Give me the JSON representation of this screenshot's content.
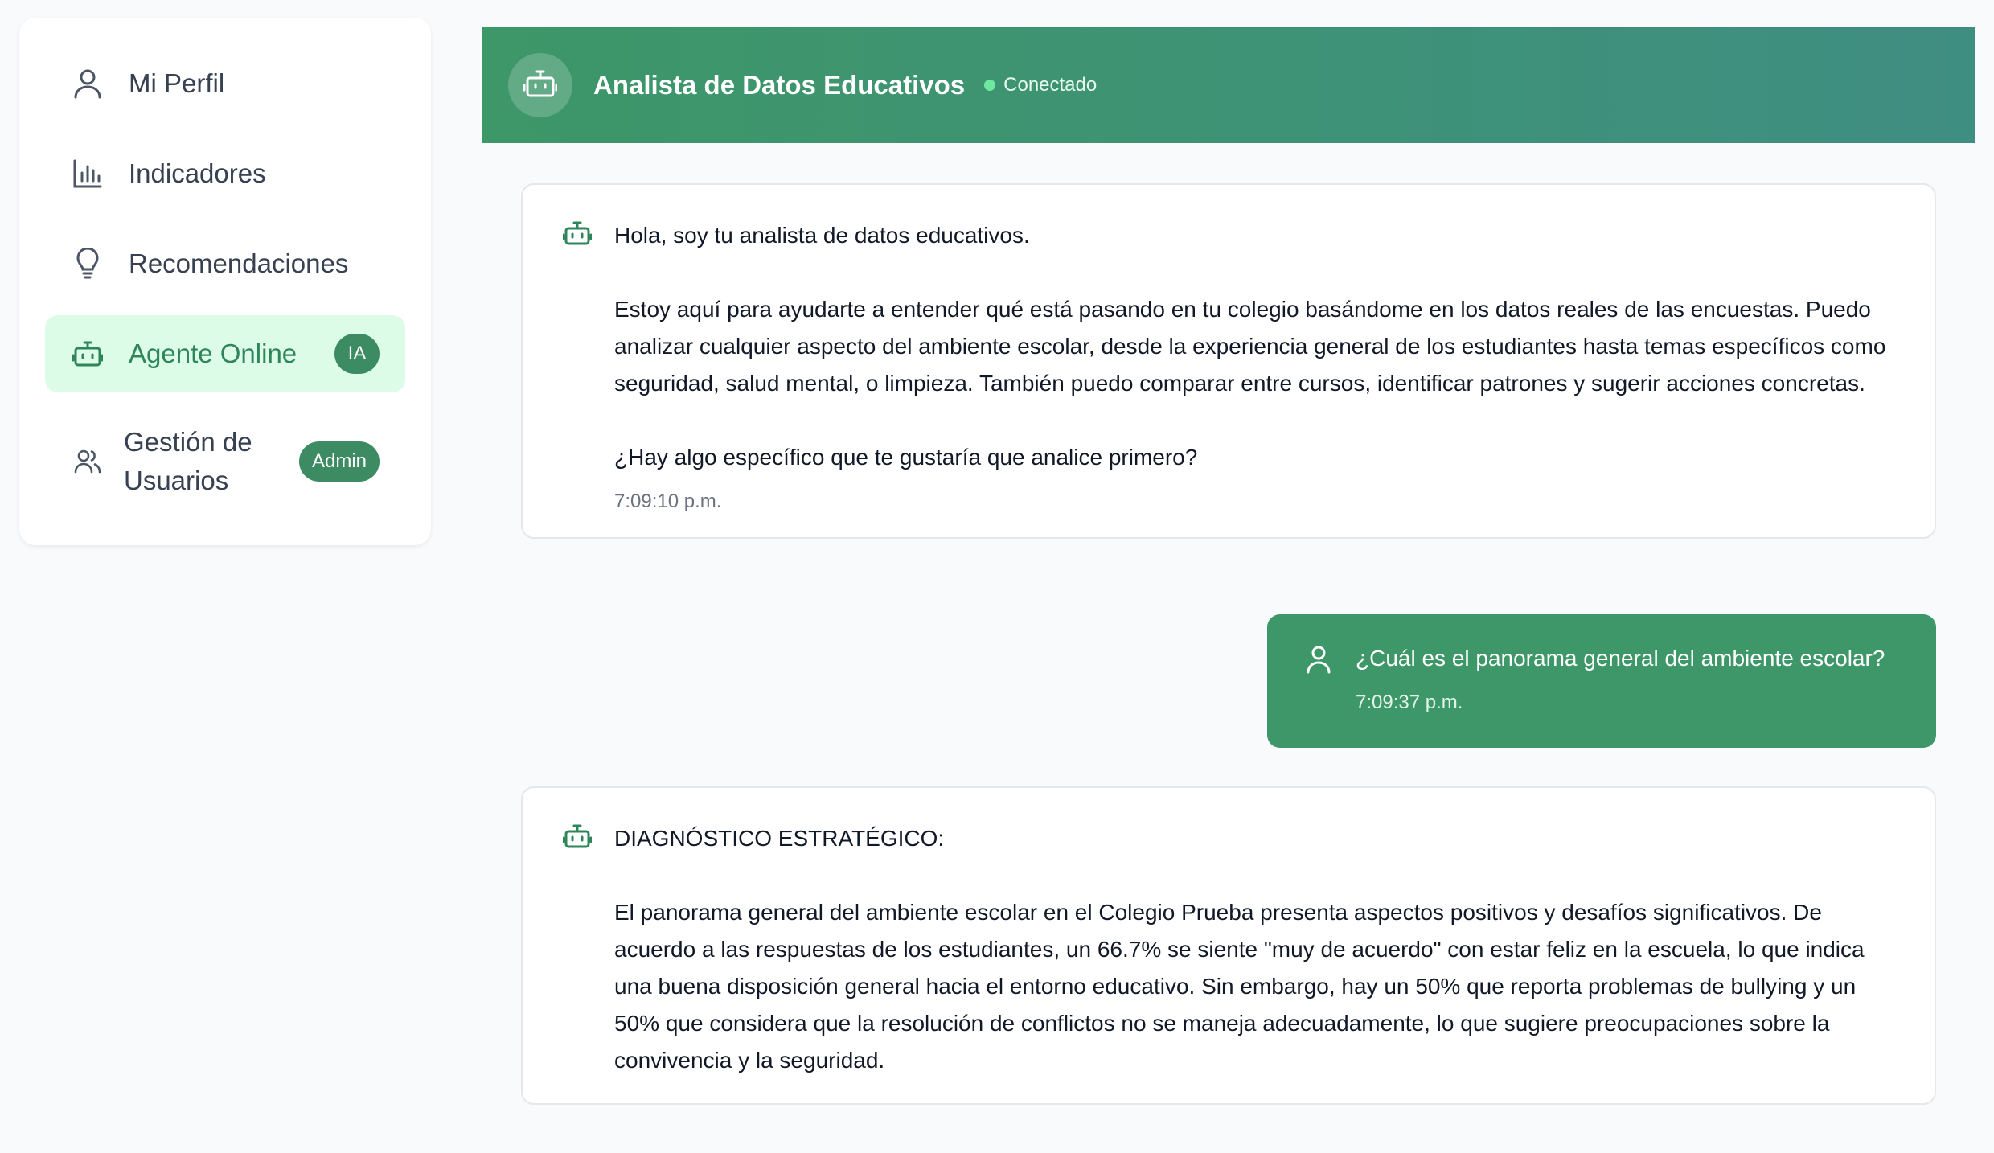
{
  "sidebar": {
    "items": [
      {
        "label": "Mi Perfil",
        "icon": "user-icon"
      },
      {
        "label": "Indicadores",
        "icon": "bar-chart-icon"
      },
      {
        "label": "Recomendaciones",
        "icon": "lightbulb-icon"
      },
      {
        "label": "Agente Online",
        "icon": "robot-icon",
        "badge": "IA",
        "active": true
      },
      {
        "label": "Gestión de Usuarios",
        "icon": "users-icon",
        "badge": "Admin"
      }
    ]
  },
  "chat": {
    "title": "Analista de Datos Educativos",
    "status": "Conectado",
    "messages": [
      {
        "role": "bot",
        "text": "Hola, soy tu analista de datos educativos.\n\nEstoy aquí para ayudarte a entender qué está pasando en tu colegio basándome en los datos reales de las encuestas. Puedo analizar cualquier aspecto del ambiente escolar, desde la experiencia general de los estudiantes hasta temas específicos como seguridad, salud mental, o limpieza. También puedo comparar entre cursos, identificar patrones y sugerir acciones concretas.\n\n¿Hay algo específico que te gustaría que analice primero?",
        "time": "7:09:10 p.m."
      },
      {
        "role": "user",
        "text": "¿Cuál es el panorama general del ambiente escolar?",
        "time": "7:09:37 p.m."
      },
      {
        "role": "bot",
        "text": "DIAGNÓSTICO ESTRATÉGICO:\n\nEl panorama general del ambiente escolar en el Colegio Prueba presenta aspectos positivos y desafíos significativos. De acuerdo a las respuestas de los estudiantes, un 66.7% se siente \"muy de acuerdo\" con estar feliz en la escuela, lo que indica una buena disposición general hacia el entorno educativo. Sin embargo, hay un 50% que reporta problemas de bullying y un 50% que considera que la resolución de conflictos no se maneja adecuadamente, lo que sugiere preocupaciones sobre la convivencia y la seguridad."
      }
    ]
  },
  "colors": {
    "accent": "#3d9768",
    "active_bg": "#dcfce7",
    "badge": "#3d8b63"
  }
}
